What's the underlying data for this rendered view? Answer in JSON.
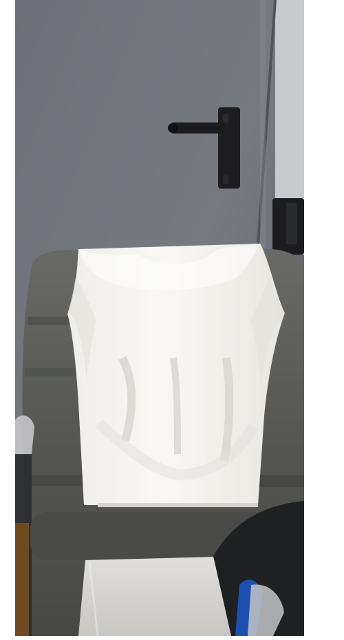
{
  "image": {
    "kind": "photo",
    "colors": {
      "background": "#ffffff",
      "door": "#70737b",
      "door_dark": "#5f636b",
      "wall_right": "#c8c9cc",
      "handle": "#1e1e20",
      "chair": "#5a5b58",
      "chair_shadow": "#3d3e3d",
      "shirt": "#f4f2ee",
      "shirt_shadow": "#dcdad5",
      "cloth_bottom": "#d9d8d6",
      "dark_object": "#1f2021",
      "blue_object": "#1d4fb2"
    }
  }
}
